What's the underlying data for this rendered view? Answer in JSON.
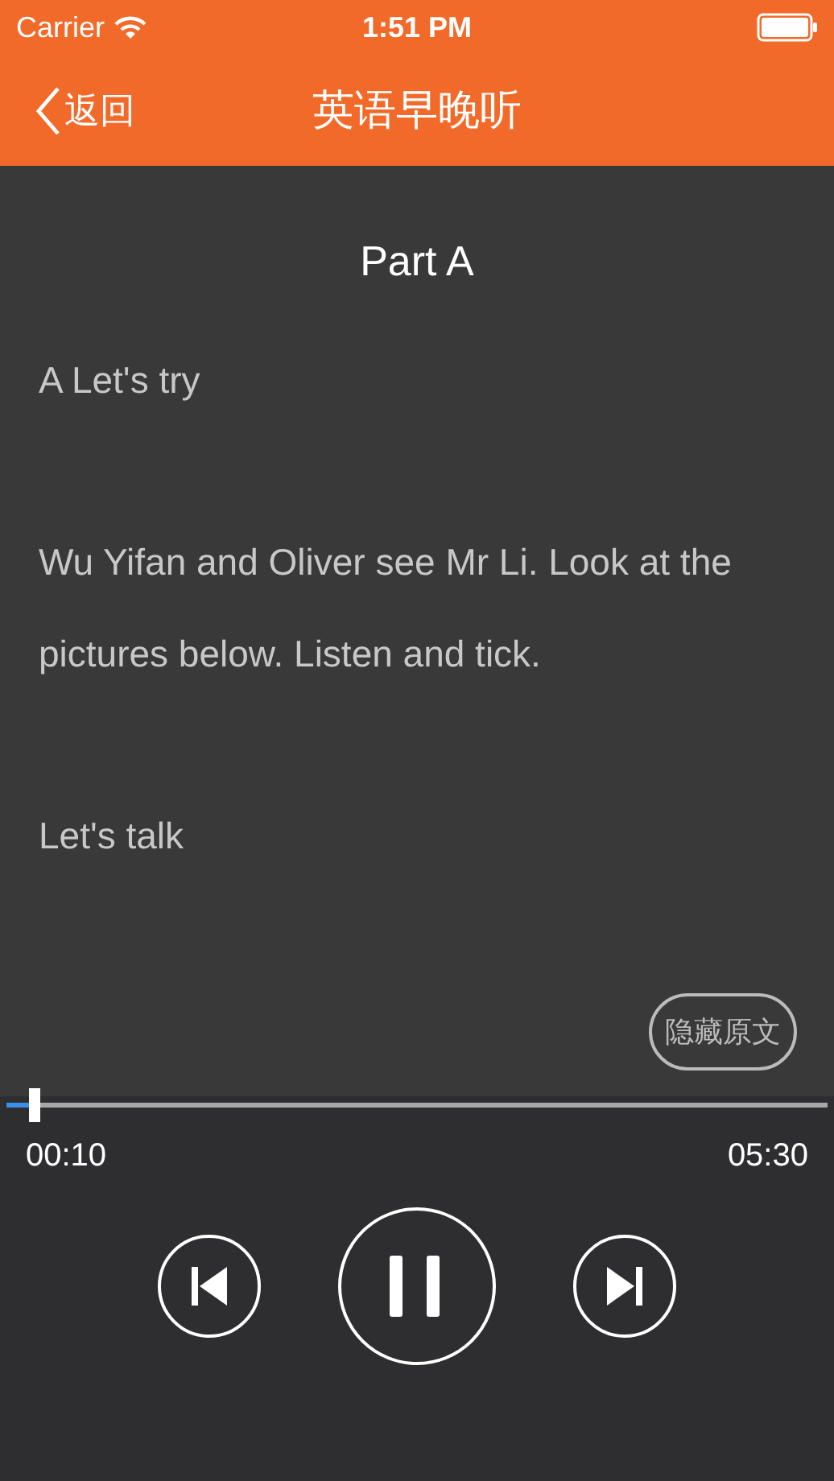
{
  "status_bar": {
    "carrier": "Carrier",
    "time": "1:51 PM"
  },
  "nav": {
    "back": "返回",
    "title": "英语早晚听"
  },
  "transcript": {
    "title": "Part A",
    "paragraphs": [
      "A Let's try",
      "Wu Yifan and Oliver see Mr Li. Look at the pictures below. Listen and tick.",
      "Let's talk"
    ],
    "toggle": "隐藏原文"
  },
  "player": {
    "level": 0.03,
    "elapsed": "00:10",
    "duration": "05:30",
    "playing": true
  }
}
